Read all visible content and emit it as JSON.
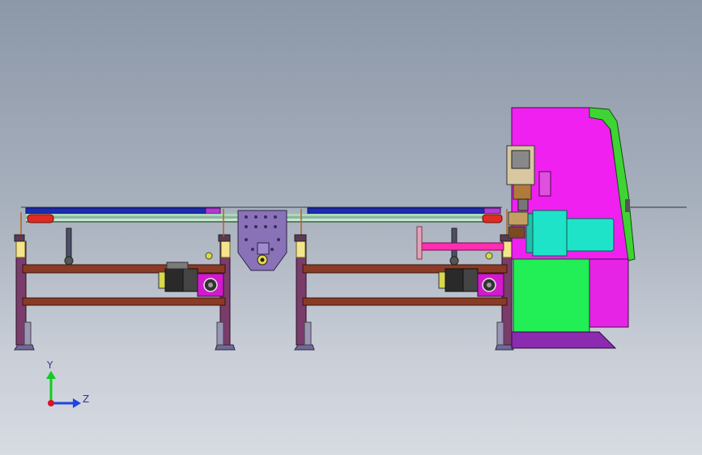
{
  "triad": {
    "y_label": "Y",
    "z_label": "Z",
    "y_color": "#11cc22",
    "z_color": "#2244dd",
    "origin_color": "#dd1122"
  },
  "colors": {
    "frame_steel": "#7a3c6b",
    "crossbar": "#8a3b25",
    "rail_blue": "#1c2bb0",
    "rail_green": "#a9d9b8",
    "red_end": "#e12a22",
    "plate_purple": "#8a72b8",
    "machine_magenta": "#f020f0",
    "machine_green": "#22ee55",
    "motor_cyan": "#1ee3c8",
    "guard_green": "#3fd433",
    "pipe_pink": "#ff2db0"
  }
}
